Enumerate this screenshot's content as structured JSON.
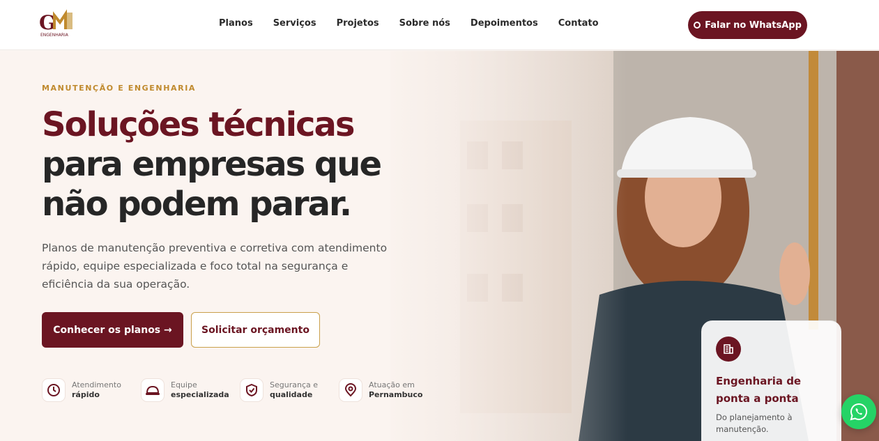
{
  "brand": {
    "logo_letters": "GM",
    "logo_sub": "ENGENHARIA"
  },
  "nav": {
    "items": [
      "Planos",
      "Serviços",
      "Projetos",
      "Sobre nós",
      "Depoimentos",
      "Contato"
    ]
  },
  "header": {
    "whatsapp_label": "Falar no WhatsApp"
  },
  "hero": {
    "eyebrow": "MANUTENÇÃO E ENGENHARIA",
    "title_line1": "Soluções técnicas",
    "title_line2": "para empresas que",
    "title_line3": "não podem parar.",
    "lead": "Planos de manutenção preventiva e corretiva com atendimento rápido, equipe especializada e foco total na segurança e eficiência da sua operação.",
    "primary_cta": "Conhecer os planos →",
    "secondary_cta": "Solicitar orçamento"
  },
  "features": [
    {
      "icon": "clock-icon",
      "line1": "Atendimento",
      "line2": "rápido"
    },
    {
      "icon": "hard-hat-icon",
      "line1": "Equipe",
      "line2": "especializada"
    },
    {
      "icon": "shield-check-icon",
      "line1": "Segurança e",
      "line2": "qualidade"
    },
    {
      "icon": "map-pin-icon",
      "line1": "Atuação em",
      "line2": "Pernambuco"
    }
  ],
  "card": {
    "icon": "building-icon",
    "title": "Engenharia de ponta a ponta",
    "desc": "Do planejamento à manutenção."
  },
  "colors": {
    "brand": "#6b1522",
    "accent": "#c08a2e",
    "whatsapp": "#25d366"
  }
}
